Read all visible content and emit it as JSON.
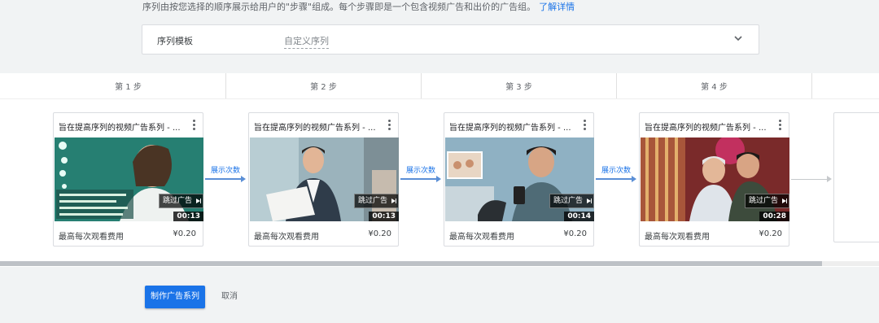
{
  "intro": {
    "text": "序列由按您选择的顺序展示给用户的\"步骤\"组成。每个步骤即是一个包含视频广告和出价的广告组。",
    "link": "了解详情"
  },
  "template": {
    "label": "序列模板",
    "value": "自定义序列"
  },
  "steps": [
    {
      "label": "第 1 步",
      "title": "旨在提高序列的视频广告系列 - ...",
      "skip": "跳过广告",
      "duration": "00:13",
      "cost_label": "最高每次观看费用",
      "cost_value": "¥0.20"
    },
    {
      "label": "第 2 步",
      "title": "旨在提高序列的视频广告系列 - ...",
      "skip": "跳过广告",
      "duration": "00:13",
      "cost_label": "最高每次观看费用",
      "cost_value": "¥0.20"
    },
    {
      "label": "第 3 步",
      "title": "旨在提高序列的视频广告系列 - ...",
      "skip": "跳过广告",
      "duration": "00:14",
      "cost_label": "最高每次观看费用",
      "cost_value": "¥0.20"
    },
    {
      "label": "第 4 步",
      "title": "旨在提高序列的视频广告系列 - ...",
      "skip": "跳过广告",
      "duration": "00:28",
      "cost_label": "最高每次观看费用",
      "cost_value": "¥0.20"
    }
  ],
  "connector_label": "展示次数",
  "actions": {
    "create": "制作广告系列",
    "cancel": "取消"
  },
  "colors": {
    "accent": "#1a73e8",
    "background": "#f1f3f4"
  }
}
